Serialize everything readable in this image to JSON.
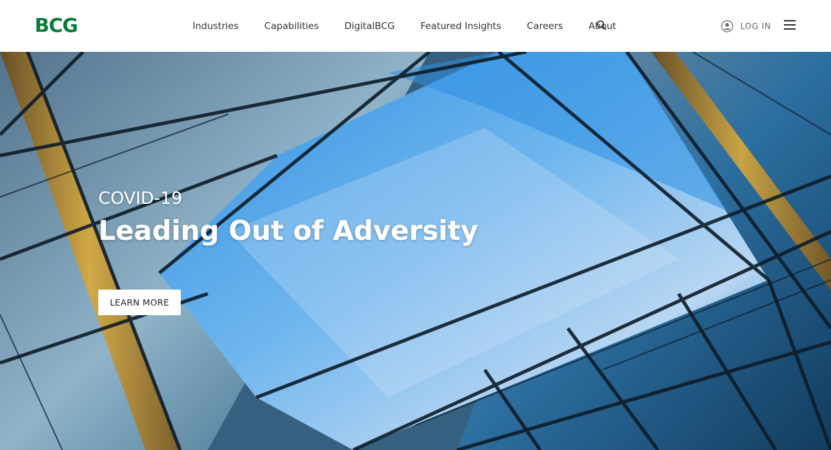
{
  "header": {
    "logo_text": "BCG",
    "nav_items": [
      "Industries",
      "Capabilities",
      "DigitalBCG",
      "Featured Insights",
      "Careers",
      "About"
    ],
    "search_icon": "search-icon",
    "login_icon": "user-circle-icon",
    "login_label": "LOG IN",
    "menu_icon": "hamburger-menu-icon"
  },
  "hero": {
    "eyebrow": "COVID-19",
    "title": "Leading Out of Adversity",
    "button_label": "LEARN MORE"
  },
  "colors": {
    "brand_green": "#0a7a3b",
    "nav_text": "#323232",
    "hero_text": "#ffffff",
    "button_bg": "#ffffff",
    "button_text": "#1e1e1e"
  }
}
